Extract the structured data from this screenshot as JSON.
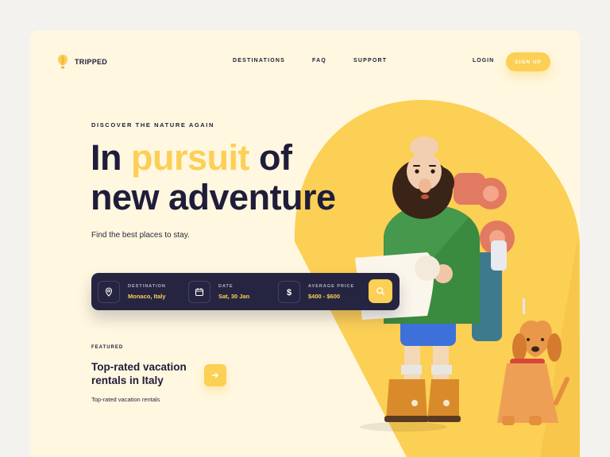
{
  "brand": {
    "name": "TRIPPED",
    "logo_icon": "hot-air-balloon-icon",
    "accent": "#fccf55",
    "dark": "#262541",
    "background": "#fff7df"
  },
  "nav": {
    "items": [
      "DESTINATIONS",
      "FAQ",
      "SUPPORT"
    ],
    "login": "LOGIN",
    "signup": "SIGN UP"
  },
  "hero": {
    "eyebrow": "DISCOVER THE NATURE AGAIN",
    "headline_before": "In ",
    "headline_accent": "pursuit",
    "headline_after": " of",
    "headline_line2": "new adventure",
    "subtitle": "Find the best places to stay."
  },
  "search": {
    "destination": {
      "label": "DESTINATION",
      "value": "Monaco, Italy",
      "icon": "location-pin-icon"
    },
    "date": {
      "label": "DATE",
      "value": "Sat, 30 Jan",
      "icon": "calendar-icon"
    },
    "price": {
      "label": "AVERAGE PRICE",
      "value": "$400 - $600",
      "icon": "dollar-icon"
    },
    "button_icon": "search-icon"
  },
  "featured": {
    "label": "FEATURED",
    "title": "Top-rated vacation rentals in Italy",
    "subtitle": "Top-rated vacation rentals",
    "button_icon": "arrow-right-icon"
  }
}
